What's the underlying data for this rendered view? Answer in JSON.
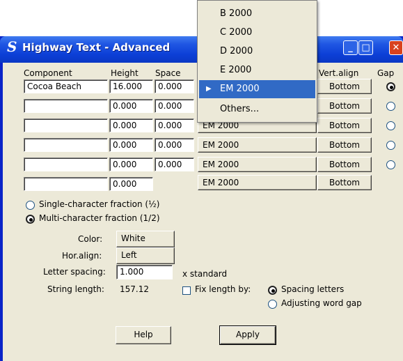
{
  "window": {
    "title": "Highway Text - Advanced",
    "title_icon": "highway-s-icon",
    "controls": {
      "minimize": "minimize-icon",
      "maximize": "maximize-icon",
      "close": "close-icon"
    }
  },
  "table": {
    "headers": {
      "component": "Component",
      "height": "Height",
      "space": "Space",
      "vert_align": "Vert.align",
      "gap": "Gap"
    },
    "rows": [
      {
        "component": "Cocoa Beach",
        "height": "16.000",
        "space": "0.000",
        "font": "EM 2000",
        "vert_align": "Bottom",
        "gap": true
      },
      {
        "component": "",
        "height": "0.000",
        "space": "0.000",
        "font": "EM 2000",
        "vert_align": "Bottom",
        "gap": false
      },
      {
        "component": "",
        "height": "0.000",
        "space": "0.000",
        "font": "EM 2000",
        "vert_align": "Bottom",
        "gap": false
      },
      {
        "component": "",
        "height": "0.000",
        "space": "0.000",
        "font": "EM 2000",
        "vert_align": "Bottom",
        "gap": false
      },
      {
        "component": "",
        "height": "0.000",
        "space": "0.000",
        "font": "EM 2000",
        "vert_align": "Bottom",
        "gap": false
      },
      {
        "component": "",
        "height": "0.000",
        "font": "EM 2000",
        "vert_align": "Bottom"
      }
    ]
  },
  "fraction": {
    "single_label": "Single-character fraction (½)",
    "multi_label": "Multi-character fraction (1/2)",
    "selected": "multi"
  },
  "settings": {
    "color_label": "Color:",
    "color_value": "White",
    "hor_align_label": "Hor.align:",
    "hor_align_value": "Left",
    "letter_spacing_label": "Letter spacing:",
    "letter_spacing_value": "1.000",
    "letter_spacing_unit": "x  standard",
    "string_length_label": "String length:",
    "string_length_value": "157.12",
    "fix_length_label": "Fix length by:",
    "fix_option_spacing": "Spacing letters",
    "fix_option_word_gap": "Adjusting word gap",
    "fix_selected": "spacing"
  },
  "buttons": {
    "help": "Help",
    "apply": "Apply"
  },
  "font_dropdown": {
    "items": [
      "B 2000",
      "C 2000",
      "D 2000",
      "E 2000",
      "EM 2000",
      "Others..."
    ],
    "selected": "EM 2000",
    "selected_arrow": "▶"
  },
  "colors": {
    "titlebar": "#0a37c4",
    "dialog_bg": "#ece9d8",
    "selection": "#316ac5",
    "close_button": "#d8421e"
  }
}
